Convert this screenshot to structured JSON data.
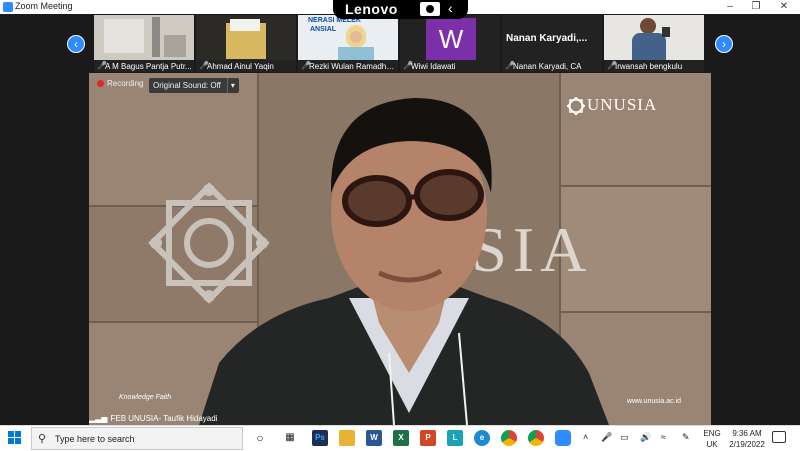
{
  "window": {
    "title": "Zoom Meeting"
  },
  "device": {
    "brand": "Lenovo"
  },
  "gallery": {
    "participants": [
      {
        "name": "A M Bagus Pantja Putr...",
        "tile": "#c9c3b9"
      },
      {
        "name": "Ahmad Ainul Yaqin",
        "tile": "#2c2a27"
      },
      {
        "name": "Rezki Wulan Ramadha...",
        "tile": "#6fb3d3",
        "banner_line1": "NERASI MELEK",
        "banner_line2": "ANSIAL"
      },
      {
        "name": "Wiwi Idawati",
        "tile": "#7b2fa8",
        "initial": "W"
      },
      {
        "name": "Nanan Karyadi, CA",
        "tile": "#222222",
        "display_name": "Nanan  Karyadi,..."
      },
      {
        "name": "Irwansah bengkulu",
        "tile": "#3e5f7a"
      }
    ],
    "prev_icon": "chevron-left-icon",
    "next_icon": "chevron-right-icon"
  },
  "stage": {
    "recording_label": "Recording",
    "original_sound_label": "Original Sound: Off",
    "logo_text": "UNUSIA",
    "wall_text": "USIA",
    "footer_text": "Knowledge Faith",
    "website": "www.unusia.ac.id",
    "presenter_name": "FEB UNUSIA- Taufik Hidayadi"
  },
  "taskbar": {
    "search_placeholder": "Type here to search",
    "apps": [
      {
        "name": "task-view",
        "label": "",
        "color": "#333333"
      },
      {
        "name": "photoshop",
        "label": "Ps",
        "color": "#1e2f55"
      },
      {
        "name": "file-explorer",
        "label": "",
        "color": "#e8b235"
      },
      {
        "name": "word",
        "label": "W",
        "color": "#2b5797"
      },
      {
        "name": "excel",
        "label": "X",
        "color": "#1e7145"
      },
      {
        "name": "powerpoint",
        "label": "P",
        "color": "#d24726"
      },
      {
        "name": "app-l",
        "label": "L",
        "color": "#1aa3b8"
      },
      {
        "name": "edge",
        "label": "e",
        "color": "#1b8ad3"
      },
      {
        "name": "chrome",
        "label": "",
        "color": "#db4437"
      },
      {
        "name": "chrome-2",
        "label": "",
        "color": "#f4b400"
      },
      {
        "name": "zoom",
        "label": "",
        "color": "#2d8cff"
      }
    ],
    "language_line1": "ENG",
    "language_line2": "UK",
    "time": "9:36 AM",
    "date": "2/19/2022"
  }
}
